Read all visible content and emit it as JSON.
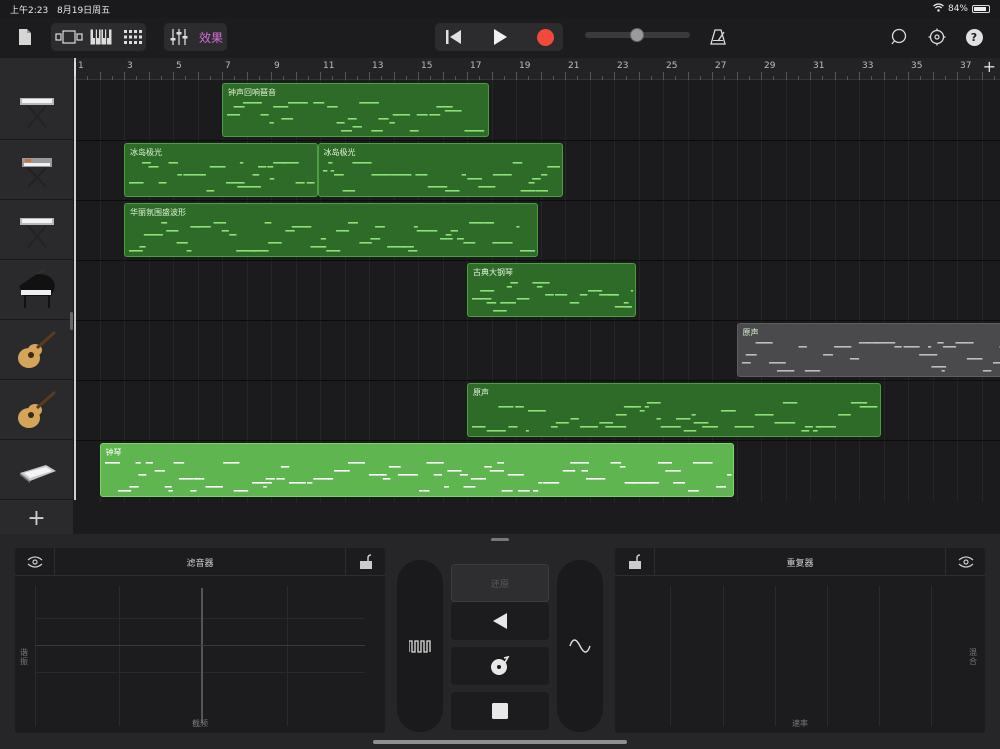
{
  "status_bar": {
    "time": "上午2:23",
    "date": "8月19日周五",
    "battery": "84%"
  },
  "toolbar": {
    "fx_label": "效果",
    "icons": [
      "document-icon",
      "view-toggle-icon",
      "keyboard-icon",
      "grid-icon",
      "mixer-icon",
      "rewind-icon",
      "play-icon",
      "record-icon",
      "metronome-icon",
      "loop-icon",
      "settings-icon",
      "help-icon"
    ],
    "help_glyph": "?",
    "accent_fx": "#d66bd6",
    "record_color": "#f24a3a"
  },
  "ruler": {
    "bars": [
      "1",
      "3",
      "5",
      "7",
      "9",
      "11",
      "13",
      "15",
      "17",
      "19",
      "21",
      "23",
      "25",
      "27",
      "29",
      "31",
      "33",
      "35",
      "37"
    ],
    "add_glyph": "+"
  },
  "tracks": [
    {
      "instrument": "keyboard-stand-icon"
    },
    {
      "instrument": "synth-stand-icon"
    },
    {
      "instrument": "keyboard-stand-icon"
    },
    {
      "instrument": "grand-piano-icon"
    },
    {
      "instrument": "acoustic-guitar-icon"
    },
    {
      "instrument": "acoustic-guitar-icon"
    },
    {
      "instrument": "keyboard-flat-icon"
    }
  ],
  "add_track_glyph": "+",
  "regions": [
    {
      "track": 0,
      "label": "钟声回响琶音",
      "start_bar": 7.0,
      "end_bar": 17.9,
      "style": "dark"
    },
    {
      "track": 1,
      "label": "冰岛极光",
      "start_bar": 3.0,
      "end_bar": 10.9,
      "style": "dark"
    },
    {
      "track": 1,
      "label": "冰岛极光",
      "start_bar": 10.9,
      "end_bar": 20.9,
      "style": "dark"
    },
    {
      "track": 2,
      "label": "华丽氛围盛波形",
      "start_bar": 3.0,
      "end_bar": 19.9,
      "style": "dark"
    },
    {
      "track": 3,
      "label": "古典大钢琴",
      "start_bar": 17.0,
      "end_bar": 23.9,
      "style": "dark"
    },
    {
      "track": 4,
      "label": "原声",
      "start_bar": 28.0,
      "end_bar": 39.0,
      "style": "gray"
    },
    {
      "track": 5,
      "label": "原声",
      "start_bar": 17.0,
      "end_bar": 33.9,
      "style": "dark"
    },
    {
      "track": 6,
      "label": "钟琴",
      "start_bar": 2.0,
      "end_bar": 27.9,
      "style": "bright"
    }
  ],
  "fx_panel": {
    "left_pad": {
      "title": "滤音器",
      "x_label": "截频",
      "y_label": "谐振"
    },
    "right_pad": {
      "title": "重复器",
      "x_label": "速率",
      "y_label": "混合"
    },
    "center": {
      "top_button": "还原"
    },
    "icons": [
      "filter-shape-icon",
      "wave-shape-icon",
      "reverse-icon",
      "scratch-icon",
      "stop-icon",
      "lock-open-icon",
      "pad-reset-icon"
    ]
  },
  "colors": {
    "region_dark": "#2e6b28",
    "region_bright": "#5fb54f",
    "note_green": "#8ee27a"
  }
}
